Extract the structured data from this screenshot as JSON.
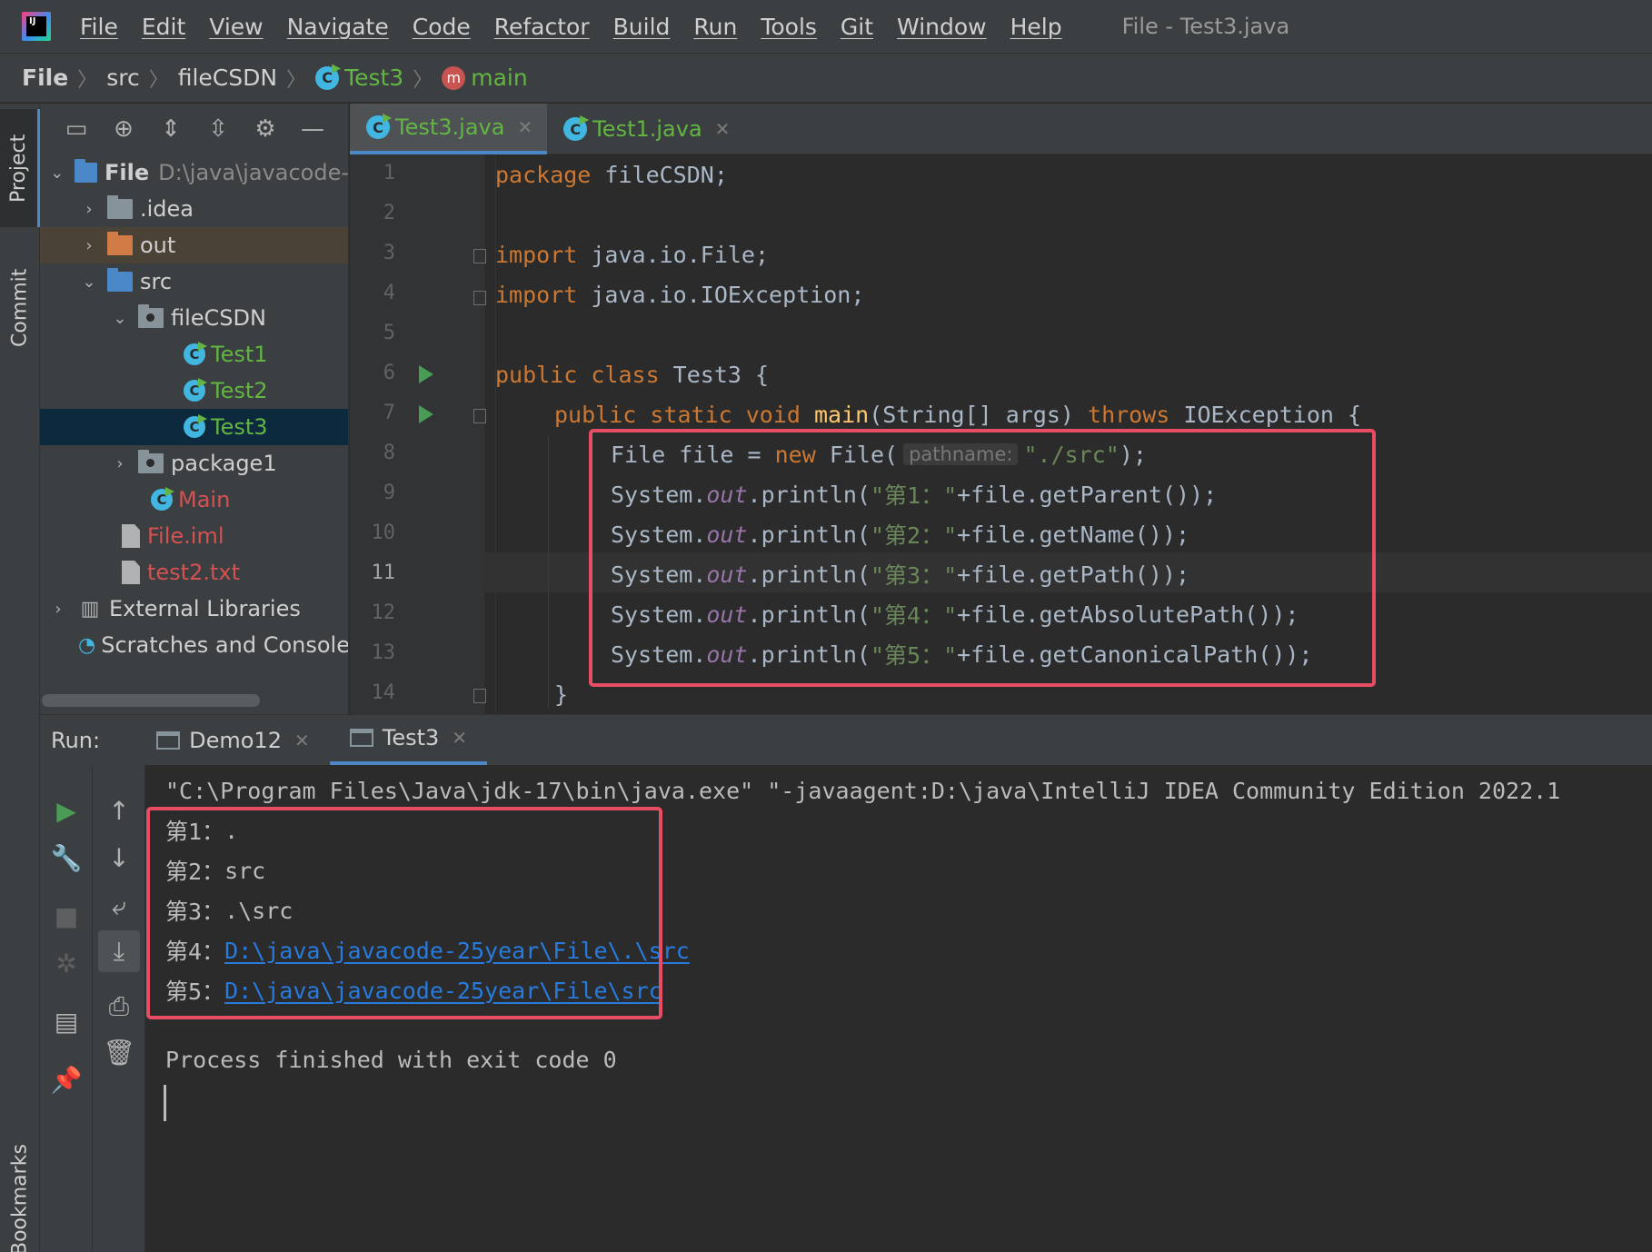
{
  "menubar": {
    "items": [
      "File",
      "Edit",
      "View",
      "Navigate",
      "Code",
      "Refactor",
      "Build",
      "Run",
      "Tools",
      "Git",
      "Window",
      "Help"
    ],
    "window_title": "File - Test3.java"
  },
  "breadcrumb": [
    "File",
    "src",
    "fileCSDN",
    "Test3",
    "main"
  ],
  "left_strip": {
    "project": "Project",
    "commit": "Commit",
    "bookmarks": "Bookmarks"
  },
  "project_tree": {
    "root_name": "File",
    "root_path": "D:\\java\\javacode-",
    "items": [
      ".idea",
      "out",
      "src",
      "fileCSDN",
      "Test1",
      "Test2",
      "Test3",
      "package1",
      "Main",
      "File.iml",
      "test2.txt",
      "External Libraries",
      "Scratches and Consoles"
    ]
  },
  "editor": {
    "tabs": [
      "Test3.java",
      "Test1.java"
    ],
    "line_numbers": [
      "1",
      "2",
      "3",
      "4",
      "5",
      "6",
      "7",
      "8",
      "9",
      "10",
      "11",
      "12",
      "13",
      "14"
    ],
    "code": {
      "l1_kw": "package",
      "l1_rest": " fileCSDN;",
      "l3_kw": "import",
      "l3_rest": " java.io.File;",
      "l4_kw": "import",
      "l4_rest": " java.io.IOException;",
      "l6_kw": "public class",
      "l6_rest": " Test3 {",
      "l7_kw1": "public static void",
      "l7_fn": " main",
      "l7_mid": "(String[] args) ",
      "l7_kw2": "throws",
      "l7_rest": " IOException {",
      "l8_a": "File file = ",
      "l8_kw": "new",
      "l8_b": " File(",
      "l8_hint": "pathname:",
      "l8_str": "\"./src\"",
      "l8_c": ");",
      "sys": "System.",
      "out": "out",
      "println": ".println(",
      "l9_str": "\"第1：\"",
      "l9_rest": "+file.getParent());",
      "l10_str": "\"第2：\"",
      "l10_rest": "+file.getName());",
      "l11_str": "\"第3：\"",
      "l11_rest": "+file.getPath());",
      "l12_str": "\"第4：\"",
      "l12_rest": "+file.getAbsolutePath());",
      "l13_str": "\"第5：\"",
      "l13_rest": "+file.getCanonicalPath());",
      "l14": "}"
    }
  },
  "run": {
    "label": "Run:",
    "tabs": [
      "Demo12",
      "Test3"
    ],
    "command": "\"C:\\Program Files\\Java\\jdk-17\\bin\\java.exe\" \"-javaagent:D:\\java\\IntelliJ IDEA Community Edition 2022.1",
    "output": [
      {
        "prefix": "第1：",
        "value": "."
      },
      {
        "prefix": "第2：",
        "value": "src"
      },
      {
        "prefix": "第3：",
        "value": ".\\src"
      },
      {
        "prefix": "第4：",
        "value": "D:\\java\\javacode-25year\\File\\.\\src"
      },
      {
        "prefix": "第5：",
        "value": "D:\\java\\javacode-25year\\File\\src"
      }
    ],
    "finished": "Process finished with exit code 0"
  },
  "colors": {
    "highlight_box": "#e84e63",
    "accent": "#4a88c7",
    "keyword": "#cc7832",
    "string": "#6a8759",
    "link": "#287bde"
  }
}
